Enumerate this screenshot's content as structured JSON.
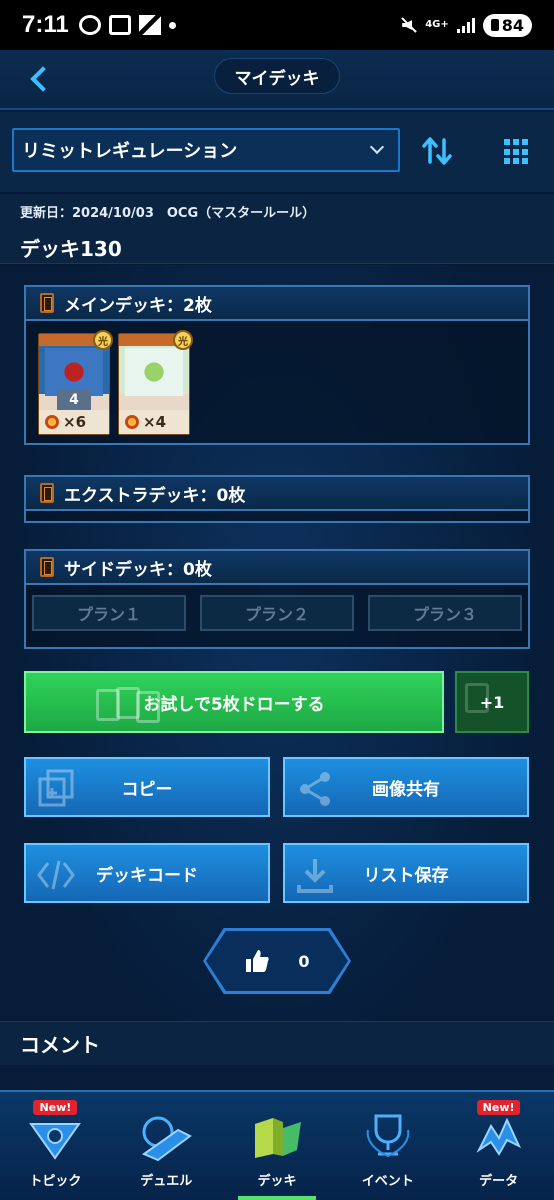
{
  "status_bar": {
    "time": "7:11",
    "network": "4G+",
    "battery": "84"
  },
  "header": {
    "title": "マイデッキ"
  },
  "filter": {
    "regulation": "リミットレギュレーション"
  },
  "deck": {
    "meta": "更新日：2024/10/03　OCG（マスタールール）",
    "name": "デッキ130"
  },
  "main_deck": {
    "label": "メインデッキ：2枚",
    "cards": [
      {
        "badge": "光",
        "level": "4",
        "count": "×6"
      },
      {
        "badge": "光",
        "level": "",
        "count": "×4"
      }
    ]
  },
  "extra_deck": {
    "label": "エクストラデッキ：0枚"
  },
  "side_deck": {
    "label": "サイドデッキ：0枚",
    "plans": [
      "プラン１",
      "プラン２",
      "プラン３"
    ]
  },
  "actions": {
    "draw_label": "お試しで5枚ドローする",
    "plus_one_label": "+1",
    "copy_label": "コピー",
    "share_label": "画像共有",
    "code_label": "デッキコード",
    "save_label": "リスト保存"
  },
  "likes": {
    "count": "0"
  },
  "comments": {
    "header": "コメント"
  },
  "nav": {
    "items": [
      {
        "label": "トピック",
        "badge": "New!",
        "icon": "topic-icon"
      },
      {
        "label": "デュエル",
        "badge": "",
        "icon": "duel-icon"
      },
      {
        "label": "デッキ",
        "badge": "",
        "icon": "deck-icon"
      },
      {
        "label": "イベント",
        "badge": "",
        "icon": "event-icon"
      },
      {
        "label": "データ",
        "badge": "New!",
        "icon": "data-icon"
      }
    ]
  },
  "colors": {
    "accent": "#3ec0ff",
    "draw_button": "#2fd35a",
    "action_button": "#1f8fe0",
    "new_badge": "#e0232f"
  }
}
